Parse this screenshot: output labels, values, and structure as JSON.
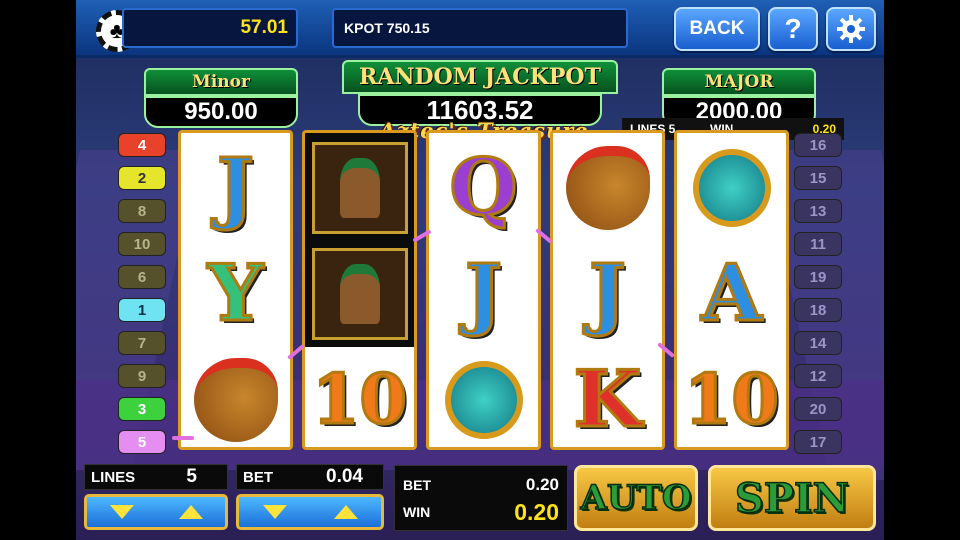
{
  "top_bar": {
    "balance": "57.01",
    "progressive_ticker": "KPOT 750.15",
    "back_label": "BACK",
    "help_label": "?",
    "settings_icon": "gear-icon",
    "chip_icon": "poker-chip-icon"
  },
  "jackpots": {
    "minor_label": "Minor",
    "minor_value": "950.00",
    "random_label": "RANDOM JACKPOT",
    "random_value": "11603.52",
    "major_label": "MAJOR",
    "major_value": "2000.00"
  },
  "game_title": "Aztec's Treasure",
  "win_info": {
    "lines_label": "LINES 5",
    "win_label": "WIN",
    "win_value": "0.20"
  },
  "left_lines": [
    "4",
    "2",
    "8",
    "10",
    "6",
    "1",
    "7",
    "9",
    "3",
    "5"
  ],
  "right_lines": [
    "16",
    "15",
    "13",
    "11",
    "19",
    "18",
    "14",
    "12",
    "20",
    "17"
  ],
  "reels": [
    [
      "J",
      "Y",
      "warrior"
    ],
    [
      "figure",
      "figure",
      "10"
    ],
    [
      "Q",
      "J",
      "shield"
    ],
    [
      "warrior",
      "J",
      "K"
    ],
    [
      "shield",
      "A",
      "10"
    ]
  ],
  "bottom": {
    "lines_label": "LINES",
    "lines_value": "5",
    "bet_label": "BET",
    "bet_value": "0.04",
    "total_bet_label": "BET",
    "total_bet_value": "0.20",
    "win_label": "WIN",
    "win_value": "0.20",
    "auto_label": "AUTO",
    "spin_label": "SPIN"
  },
  "colors": {
    "gold": "#ffe21a",
    "jackpot_green": "#0f8f3a",
    "win_line": "#e070e0",
    "button_blue": "#1a5fd0"
  }
}
